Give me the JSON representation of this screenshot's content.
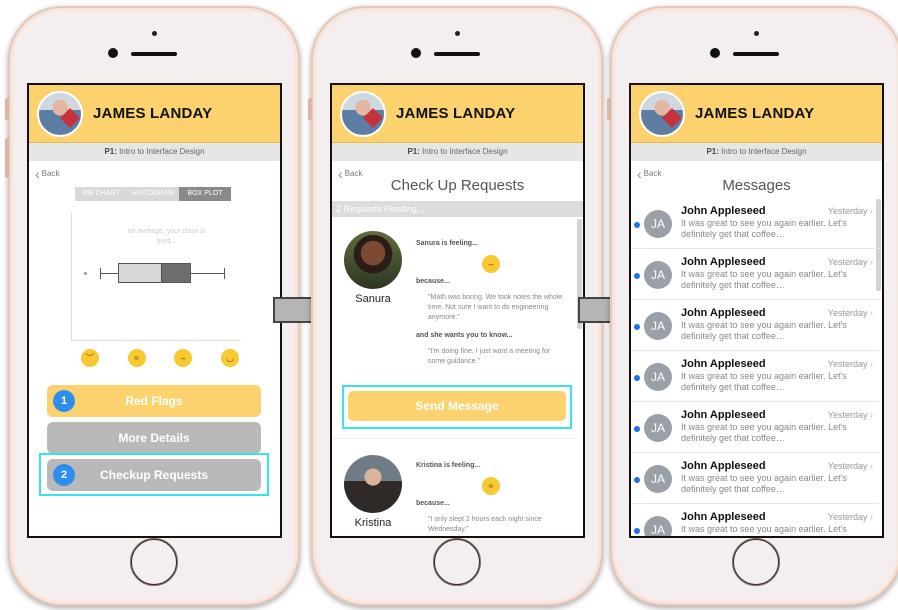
{
  "header": {
    "name": "JAMES LANDAY",
    "course_prefix": "P1:",
    "course": "Intro to Interface Design",
    "back": "Back"
  },
  "screen1": {
    "tabs": [
      "PIE CHART",
      "HISTOGRAM",
      "BOX PLOT"
    ],
    "active_tab": "BOX PLOT",
    "plot_note": "on average, your class is tired...",
    "buttons": [
      {
        "badge": "1",
        "label": "Red Flags"
      },
      {
        "label": "More Details"
      },
      {
        "badge": "2",
        "label": "Checkup Requests"
      }
    ]
  },
  "screen2": {
    "title": "Check Up Requests",
    "pending": "2 Requests Pending...",
    "requests": [
      {
        "name": "Sanura",
        "feeling": "Sanura is feeling...",
        "because": "because...",
        "reason": "\"Math was boring.  We took notes the whole time.  Not sure I want to do engineering anymore.\"",
        "wants": "and she wants you to know...",
        "message": "\"I'm doing fine, I just want a meeting for some guidance.\""
      },
      {
        "name": "Kristina",
        "feeling": "Kristina is feeling...",
        "because": "because...",
        "reason": "\"I only slept 2 hours each night since Wednesday.\""
      }
    ],
    "send_label": "Send Message"
  },
  "screen3": {
    "title": "Messages",
    "messages": [
      {
        "initials": "JA",
        "name": "John Appleseed",
        "time": "Yesterday",
        "preview": "It was great to see you again earlier. Let's definitely get that coffee…"
      },
      {
        "initials": "JA",
        "name": "John Appleseed",
        "time": "Yesterday",
        "preview": "It was great to see you again earlier. Let's definitely get that coffee…"
      },
      {
        "initials": "JA",
        "name": "John Appleseed",
        "time": "Yesterday",
        "preview": "It was great to see you again earlier. Let's definitely get that coffee…"
      },
      {
        "initials": "JA",
        "name": "John Appleseed",
        "time": "Yesterday",
        "preview": "It was great to see you again earlier. Let's definitely get that coffee…"
      },
      {
        "initials": "JA",
        "name": "John Appleseed",
        "time": "Yesterday",
        "preview": "It was great to see you again earlier. Let's definitely get that coffee…"
      },
      {
        "initials": "JA",
        "name": "John Appleseed",
        "time": "Yesterday",
        "preview": "It was great to see you again earlier. Let's definitely get that coffee…"
      },
      {
        "initials": "JA",
        "name": "John Appleseed",
        "time": "Yesterday",
        "preview": "It was great to see you again earlier. Let's"
      }
    ],
    "fab": "+"
  },
  "colors": {
    "accent_yellow": "#fcd26f",
    "badge_blue": "#2d8ef0",
    "highlight_cyan": "#36e3ee",
    "unread_dot": "#1e73e8"
  }
}
